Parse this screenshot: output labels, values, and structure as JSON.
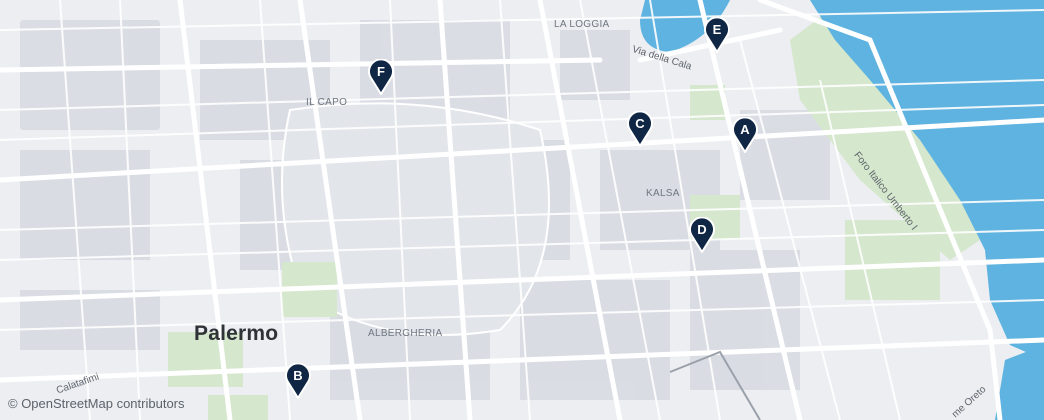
{
  "map": {
    "city_label": "Palermo",
    "district_labels": [
      "LA LOGGIA",
      "IL CAPO",
      "KALSA",
      "ALBERGHERIA"
    ],
    "street_labels": [
      "Via della Cala",
      "Foro Italico Umberto I",
      "Calatafimi",
      "me Oreto"
    ],
    "markers": [
      "A",
      "B",
      "C",
      "D",
      "E",
      "F"
    ],
    "attribution": "© OpenStreetMap contributors",
    "colors": {
      "background": "#eceef2",
      "water": "#5fb3e0",
      "park": "#d5e7cc",
      "road": "#ffffff",
      "building": "#d8dce2",
      "marker": "#0f2744"
    }
  }
}
